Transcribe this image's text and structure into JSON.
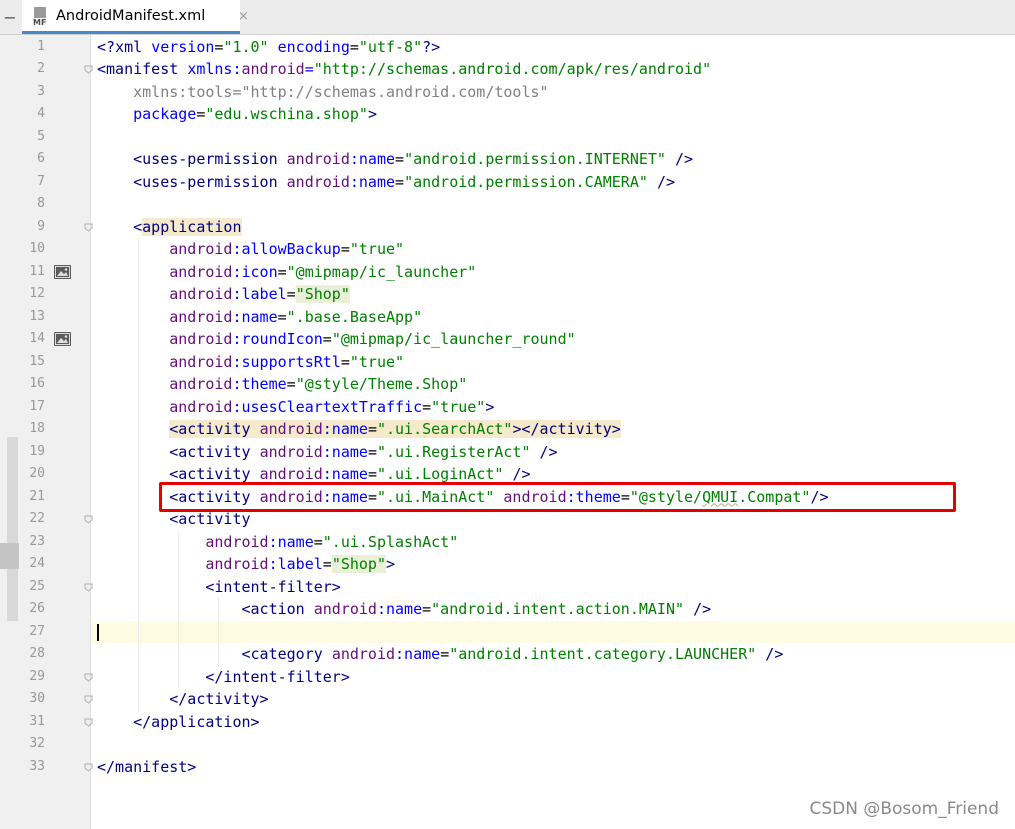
{
  "tab": {
    "icon_label": "MF",
    "title": "AndroidManifest.xml",
    "close": "×"
  },
  "lines": [
    {
      "n": "1",
      "segs": [
        [
          "t",
          "<?"
        ],
        [
          "t",
          "xml "
        ],
        [
          "at",
          "version"
        ],
        [
          "p",
          "="
        ],
        [
          "v",
          "\"1.0\""
        ],
        [
          "p",
          " "
        ],
        [
          "at",
          "encoding"
        ],
        [
          "p",
          "="
        ],
        [
          "v",
          "\"utf-8\""
        ],
        [
          "t",
          "?>"
        ]
      ]
    },
    {
      "n": "2",
      "segs": [
        [
          "t",
          "<manifest "
        ],
        [
          "at",
          "xmlns:"
        ],
        [
          "an",
          "android"
        ],
        [
          "at",
          "="
        ],
        [
          "v",
          "\"http://schemas.android.com/apk/res/android\""
        ]
      ]
    },
    {
      "n": "3",
      "segs": [
        [
          "p",
          "    "
        ],
        [
          "gray",
          "xmlns:tools="
        ],
        [
          "gray",
          "\"http://schemas.android.com/tools\""
        ]
      ]
    },
    {
      "n": "4",
      "segs": [
        [
          "p",
          "    "
        ],
        [
          "at",
          "package"
        ],
        [
          "p",
          "="
        ],
        [
          "v",
          "\"edu."
        ],
        [
          "v",
          "wschina"
        ],
        [
          "v",
          ".shop\""
        ],
        [
          "t",
          ">"
        ]
      ]
    },
    {
      "n": "5",
      "segs": []
    },
    {
      "n": "6",
      "segs": [
        [
          "p",
          "    "
        ],
        [
          "t",
          "<uses-permission "
        ],
        [
          "an",
          "android"
        ],
        [
          "at",
          ":name"
        ],
        [
          "p",
          "="
        ],
        [
          "v",
          "\"android.permission.INTERNET\""
        ],
        [
          "p",
          " "
        ],
        [
          "t",
          "/>"
        ]
      ]
    },
    {
      "n": "7",
      "segs": [
        [
          "p",
          "    "
        ],
        [
          "t",
          "<uses-permission "
        ],
        [
          "an",
          "android"
        ],
        [
          "at",
          ":name"
        ],
        [
          "p",
          "="
        ],
        [
          "v",
          "\"android.permission.CAMERA\""
        ],
        [
          "p",
          " "
        ],
        [
          "t",
          "/>"
        ]
      ]
    },
    {
      "n": "8",
      "segs": []
    },
    {
      "n": "9",
      "segs": [
        [
          "p",
          "    "
        ],
        [
          "t",
          "<"
        ],
        [
          "thl",
          "application"
        ]
      ]
    },
    {
      "n": "10",
      "segs": [
        [
          "p",
          "        "
        ],
        [
          "an",
          "android"
        ],
        [
          "at",
          ":allowBackup"
        ],
        [
          "p",
          "="
        ],
        [
          "v",
          "\"true\""
        ]
      ]
    },
    {
      "n": "11",
      "segs": [
        [
          "p",
          "        "
        ],
        [
          "an",
          "android"
        ],
        [
          "at",
          ":icon"
        ],
        [
          "p",
          "="
        ],
        [
          "v",
          "\"@mipmap/ic_launcher\""
        ]
      ]
    },
    {
      "n": "12",
      "segs": [
        [
          "p",
          "        "
        ],
        [
          "an",
          "android"
        ],
        [
          "at",
          ":label"
        ],
        [
          "p",
          "="
        ],
        [
          "vhl",
          "\"Shop\""
        ]
      ]
    },
    {
      "n": "13",
      "segs": [
        [
          "p",
          "        "
        ],
        [
          "an",
          "android"
        ],
        [
          "at",
          ":name"
        ],
        [
          "p",
          "="
        ],
        [
          "v",
          "\".base.BaseApp\""
        ]
      ]
    },
    {
      "n": "14",
      "segs": [
        [
          "p",
          "        "
        ],
        [
          "an",
          "android"
        ],
        [
          "at",
          ":roundIcon"
        ],
        [
          "p",
          "="
        ],
        [
          "v",
          "\"@mipmap/ic_launcher_round\""
        ]
      ]
    },
    {
      "n": "15",
      "segs": [
        [
          "p",
          "        "
        ],
        [
          "an",
          "android"
        ],
        [
          "at",
          ":supportsRtl"
        ],
        [
          "p",
          "="
        ],
        [
          "v",
          "\"true\""
        ]
      ]
    },
    {
      "n": "16",
      "segs": [
        [
          "p",
          "        "
        ],
        [
          "an",
          "android"
        ],
        [
          "at",
          ":theme"
        ],
        [
          "p",
          "="
        ],
        [
          "v",
          "\"@style/Theme.Shop\""
        ]
      ]
    },
    {
      "n": "17",
      "segs": [
        [
          "p",
          "        "
        ],
        [
          "an",
          "android"
        ],
        [
          "at",
          ":usesCleartextTraffic"
        ],
        [
          "p",
          "="
        ],
        [
          "v",
          "\"true\""
        ],
        [
          "t",
          ">"
        ]
      ]
    },
    {
      "n": "18",
      "segs": [
        [
          "p",
          "        "
        ],
        [
          "thl",
          "<activity "
        ],
        [
          "anhl",
          "android"
        ],
        [
          "athl",
          ":name"
        ],
        [
          "phl",
          "="
        ],
        [
          "vhl2",
          "\".ui.SearchAct\""
        ],
        [
          "thl",
          "></activity>"
        ]
      ]
    },
    {
      "n": "19",
      "segs": [
        [
          "p",
          "        "
        ],
        [
          "t",
          "<activity "
        ],
        [
          "an",
          "android"
        ],
        [
          "at",
          ":name"
        ],
        [
          "p",
          "="
        ],
        [
          "v",
          "\".ui.RegisterAct\""
        ],
        [
          "p",
          " "
        ],
        [
          "t",
          "/>"
        ]
      ]
    },
    {
      "n": "20",
      "segs": [
        [
          "p",
          "        "
        ],
        [
          "t",
          "<activity "
        ],
        [
          "an",
          "android"
        ],
        [
          "at",
          ":name"
        ],
        [
          "p",
          "="
        ],
        [
          "v",
          "\".ui.LoginAct\""
        ],
        [
          "p",
          " "
        ],
        [
          "t",
          "/>"
        ]
      ]
    },
    {
      "n": "21",
      "segs": [
        [
          "p",
          "        "
        ],
        [
          "t",
          "<activity "
        ],
        [
          "an",
          "android"
        ],
        [
          "at",
          ":name"
        ],
        [
          "p",
          "="
        ],
        [
          "v",
          "\".ui.MainAct\""
        ],
        [
          "p",
          " "
        ],
        [
          "an",
          "android"
        ],
        [
          "at",
          ":theme"
        ],
        [
          "p",
          "="
        ],
        [
          "v",
          "\"@style/"
        ],
        [
          "vul",
          "QMUI"
        ],
        [
          "v",
          ".Compat\""
        ],
        [
          "t",
          "/>"
        ]
      ]
    },
    {
      "n": "22",
      "segs": [
        [
          "p",
          "        "
        ],
        [
          "t",
          "<activity"
        ]
      ]
    },
    {
      "n": "23",
      "segs": [
        [
          "p",
          "            "
        ],
        [
          "an",
          "android"
        ],
        [
          "at",
          ":name"
        ],
        [
          "p",
          "="
        ],
        [
          "v",
          "\".ui.SplashAct\""
        ]
      ]
    },
    {
      "n": "24",
      "segs": [
        [
          "p",
          "            "
        ],
        [
          "an",
          "android"
        ],
        [
          "at",
          ":label"
        ],
        [
          "p",
          "="
        ],
        [
          "vhl",
          "\"Shop\""
        ],
        [
          "t",
          ">"
        ]
      ]
    },
    {
      "n": "25",
      "segs": [
        [
          "p",
          "            "
        ],
        [
          "t",
          "<intent-filter>"
        ]
      ]
    },
    {
      "n": "26",
      "segs": [
        [
          "p",
          "                "
        ],
        [
          "t",
          "<action "
        ],
        [
          "an",
          "android"
        ],
        [
          "at",
          ":name"
        ],
        [
          "p",
          "="
        ],
        [
          "v",
          "\"android.intent.action.MAIN\""
        ],
        [
          "p",
          " "
        ],
        [
          "t",
          "/>"
        ]
      ]
    },
    {
      "n": "27",
      "segs": []
    },
    {
      "n": "28",
      "segs": [
        [
          "p",
          "                "
        ],
        [
          "t",
          "<category "
        ],
        [
          "an",
          "android"
        ],
        [
          "at",
          ":name"
        ],
        [
          "p",
          "="
        ],
        [
          "v",
          "\"android.intent.category.LAUNCHER\""
        ],
        [
          "p",
          " "
        ],
        [
          "t",
          "/>"
        ]
      ]
    },
    {
      "n": "29",
      "segs": [
        [
          "p",
          "            "
        ],
        [
          "t",
          "</intent-filter>"
        ]
      ]
    },
    {
      "n": "30",
      "segs": [
        [
          "p",
          "        "
        ],
        [
          "t",
          "</activity>"
        ]
      ]
    },
    {
      "n": "31",
      "segs": [
        [
          "p",
          "    "
        ],
        [
          "t",
          "</application>"
        ]
      ]
    },
    {
      "n": "32",
      "segs": []
    },
    {
      "n": "33",
      "segs": [
        [
          "t",
          "</manifest>"
        ]
      ]
    }
  ],
  "gutter_icons": [
    {
      "line": "11",
      "icon": "image-icon"
    },
    {
      "line": "14",
      "icon": "image-icon"
    }
  ],
  "fold_markers": [
    "2",
    "9",
    "22",
    "25",
    "29",
    "30",
    "31",
    "33"
  ],
  "cursor_line": "27",
  "highlight_line": "21",
  "watermark": "CSDN @Bosom_Friend"
}
